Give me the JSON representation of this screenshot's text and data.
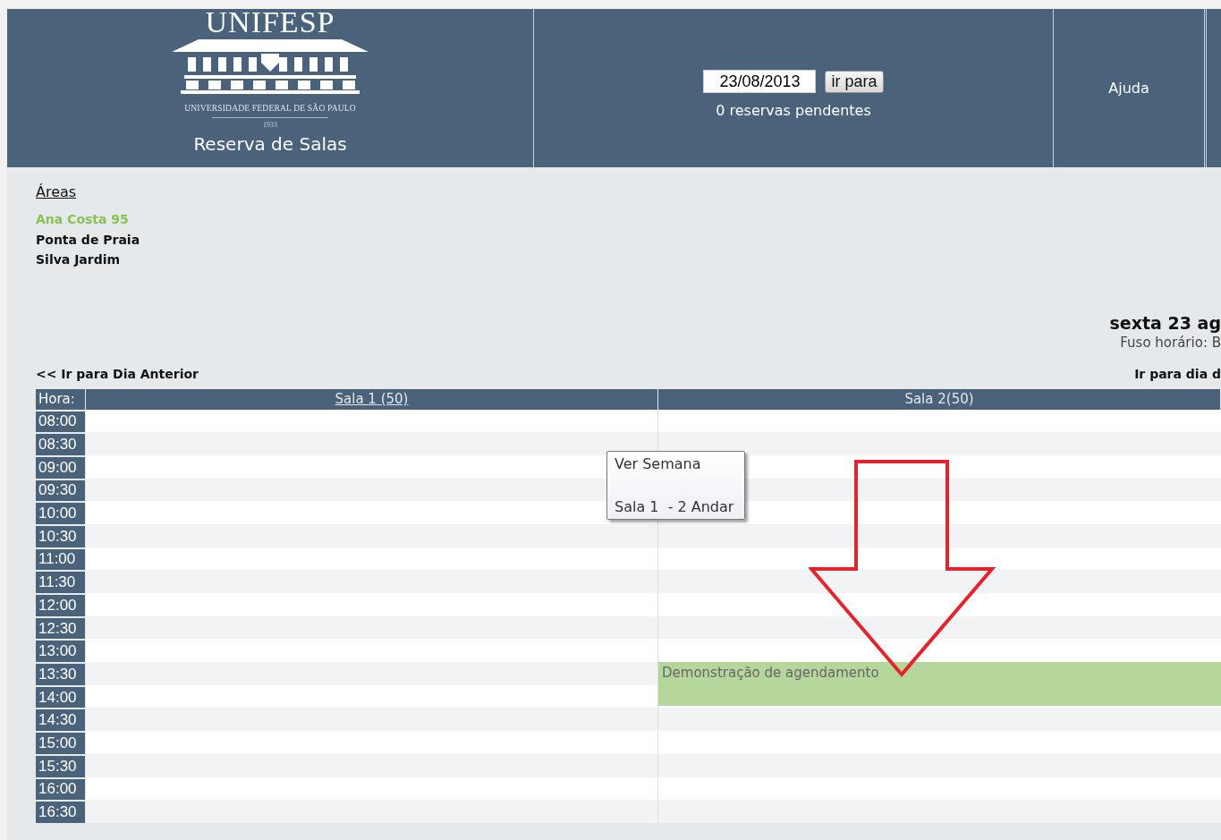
{
  "header": {
    "logo": {
      "name": "UNIFESP",
      "subtitle": "UNIVERSIDADE FEDERAL DE SÃO PAULO",
      "year": "1933"
    },
    "app_title": "Reserva de Salas",
    "date_field": {
      "value": "23/08/2013"
    },
    "go_button": "ir para",
    "pending": "0 reservas pendentes",
    "menu": [
      {
        "label": "Ajuda"
      }
    ]
  },
  "areas": {
    "title": "Áreas",
    "items": [
      {
        "label": "Ana Costa 95",
        "selected": true
      },
      {
        "label": "Ponta de Praia",
        "selected": false
      },
      {
        "label": "Silva Jardim",
        "selected": false
      }
    ]
  },
  "day": {
    "title": "sexta 23 ag",
    "timezone": "Fuso horário: B"
  },
  "nav": {
    "previous": "<< Ir para Dia Anterior",
    "next": "Ir para dia d"
  },
  "schedule": {
    "hour_heading": "Hora:",
    "columns": [
      {
        "label": "Sala 1 (50)",
        "link": true
      },
      {
        "label": "Sala 2(50)",
        "link": false
      }
    ],
    "rows": [
      {
        "time": "08:00",
        "cells": [
          {
            "booked": false
          },
          {
            "booked": false
          }
        ]
      },
      {
        "time": "08:30",
        "cells": [
          {
            "booked": false
          },
          {
            "booked": false
          }
        ]
      },
      {
        "time": "09:00",
        "cells": [
          {
            "booked": false
          },
          {
            "booked": false
          }
        ]
      },
      {
        "time": "09:30",
        "cells": [
          {
            "booked": false
          },
          {
            "booked": false
          }
        ]
      },
      {
        "time": "10:00",
        "cells": [
          {
            "booked": false
          },
          {
            "booked": false
          }
        ]
      },
      {
        "time": "10:30",
        "cells": [
          {
            "booked": false
          },
          {
            "booked": false
          }
        ]
      },
      {
        "time": "11:00",
        "cells": [
          {
            "booked": false
          },
          {
            "booked": false
          }
        ]
      },
      {
        "time": "11:30",
        "cells": [
          {
            "booked": false
          },
          {
            "booked": false
          }
        ]
      },
      {
        "time": "12:00",
        "cells": [
          {
            "booked": false
          },
          {
            "booked": false
          }
        ]
      },
      {
        "time": "12:30",
        "cells": [
          {
            "booked": false
          },
          {
            "booked": false
          }
        ]
      },
      {
        "time": "13:00",
        "cells": [
          {
            "booked": false
          },
          {
            "booked": false
          }
        ]
      },
      {
        "time": "13:30",
        "cells": [
          {
            "booked": false
          },
          {
            "booked": true,
            "text": "Demonstração de agendamento"
          }
        ]
      },
      {
        "time": "14:00",
        "cells": [
          {
            "booked": false
          },
          {
            "booked": true
          }
        ]
      },
      {
        "time": "14:30",
        "cells": [
          {
            "booked": false
          },
          {
            "booked": false
          }
        ]
      },
      {
        "time": "15:00",
        "cells": [
          {
            "booked": false
          },
          {
            "booked": false
          }
        ]
      },
      {
        "time": "15:30",
        "cells": [
          {
            "booked": false
          },
          {
            "booked": false
          }
        ]
      },
      {
        "time": "16:00",
        "cells": [
          {
            "booked": false
          },
          {
            "booked": false
          }
        ]
      },
      {
        "time": "16:30",
        "cells": [
          {
            "booked": false
          },
          {
            "booked": false
          }
        ]
      }
    ]
  },
  "context_menu": {
    "items": [
      "Ver Semana",
      "Sala 1  - 2 Andar"
    ]
  },
  "annotation": {
    "kind": "arrow"
  }
}
